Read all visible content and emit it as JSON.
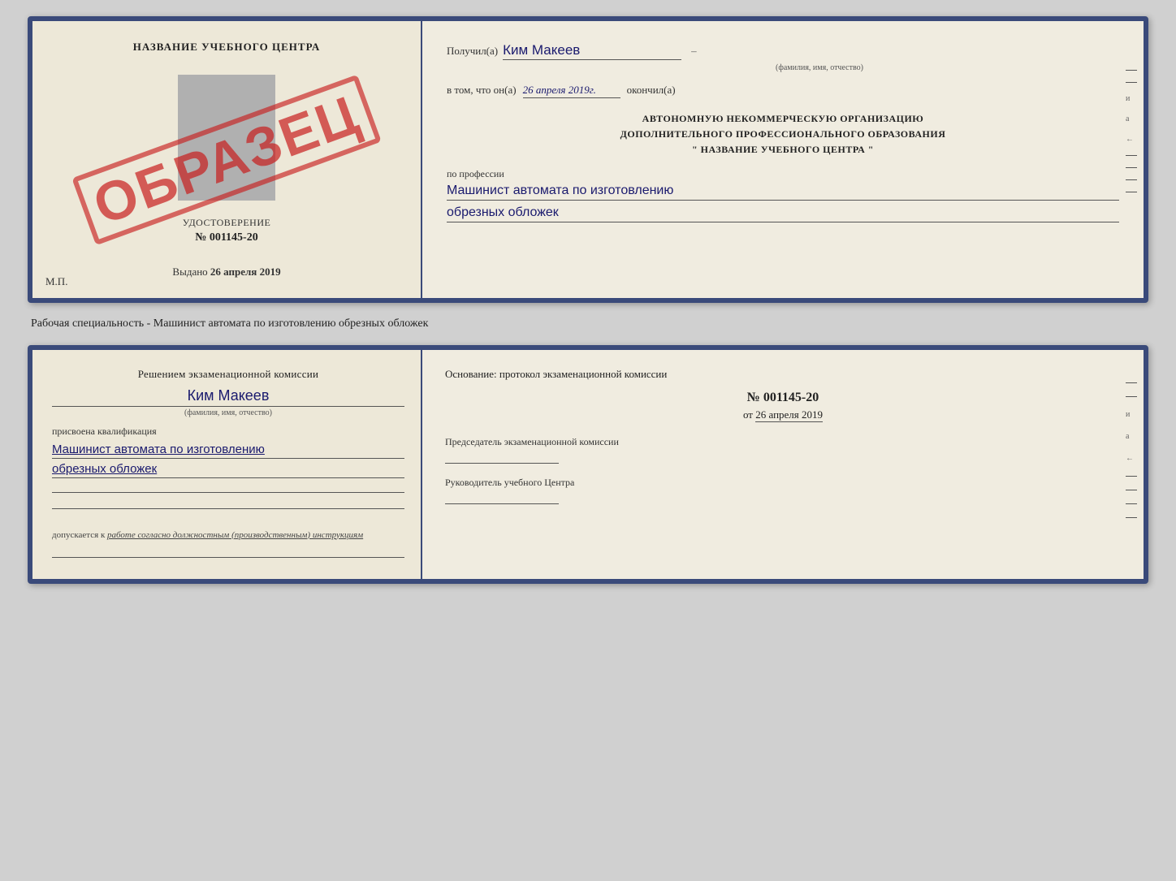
{
  "top_card": {
    "left": {
      "cert_title": "НАЗВАНИЕ УЧЕБНОГО ЦЕНТРА",
      "cert_label": "УДОСТОВЕРЕНИЕ",
      "cert_number": "№ 001145-20",
      "issued_label": "Выдано",
      "issued_date": "26 апреля 2019",
      "mp_label": "М.П.",
      "stamp_text": "ОБРАЗЕЦ"
    },
    "right": {
      "recipient_label": "Получил(а)",
      "recipient_name": "Ким Макеев",
      "recipient_dash": "–",
      "fio_hint": "(фамилия, имя, отчество)",
      "completed_prefix": "в том, что он(а)",
      "completed_date": "26 апреля 2019г.",
      "completed_suffix": "окончил(а)",
      "org_line1": "АВТОНОМНУЮ НЕКОММЕРЧЕСКУЮ ОРГАНИЗАЦИЮ",
      "org_line2": "ДОПОЛНИТЕЛЬНОГО ПРОФЕССИОНАЛЬНОГО ОБРАЗОВАНИЯ",
      "org_line3": "\"   НАЗВАНИЕ УЧЕБНОГО ЦЕНТРА   \"",
      "profession_label": "по профессии",
      "profession_line1": "Машинист автомата по изготовлению",
      "profession_line2": "обрезных обложек"
    }
  },
  "caption": "Рабочая специальность - Машинист автомата по изготовлению обрезных обложек",
  "bottom_card": {
    "left": {
      "commission_intro": "Решением экзаменационной комиссии",
      "person_name": "Ким Макеев",
      "fio_hint": "(фамилия, имя, отчество)",
      "qualification_label": "присвоена квалификация",
      "qualification_line1": "Машинист автомата по изготовлению",
      "qualification_line2": "обрезных обложек",
      "blank1": "",
      "blank2": "",
      "допускается_label": "допускается к",
      "допускается_value": "работе согласно должностным (производственным) инструкциям"
    },
    "right": {
      "osnov_label": "Основание: протокол экзаменационной комиссии",
      "protocol_number": "№ 001145-20",
      "protocol_date_prefix": "от",
      "protocol_date": "26 апреля 2019",
      "chairman_label": "Председатель экзаменационной комиссии",
      "head_label": "Руководитель учебного Центра"
    }
  }
}
